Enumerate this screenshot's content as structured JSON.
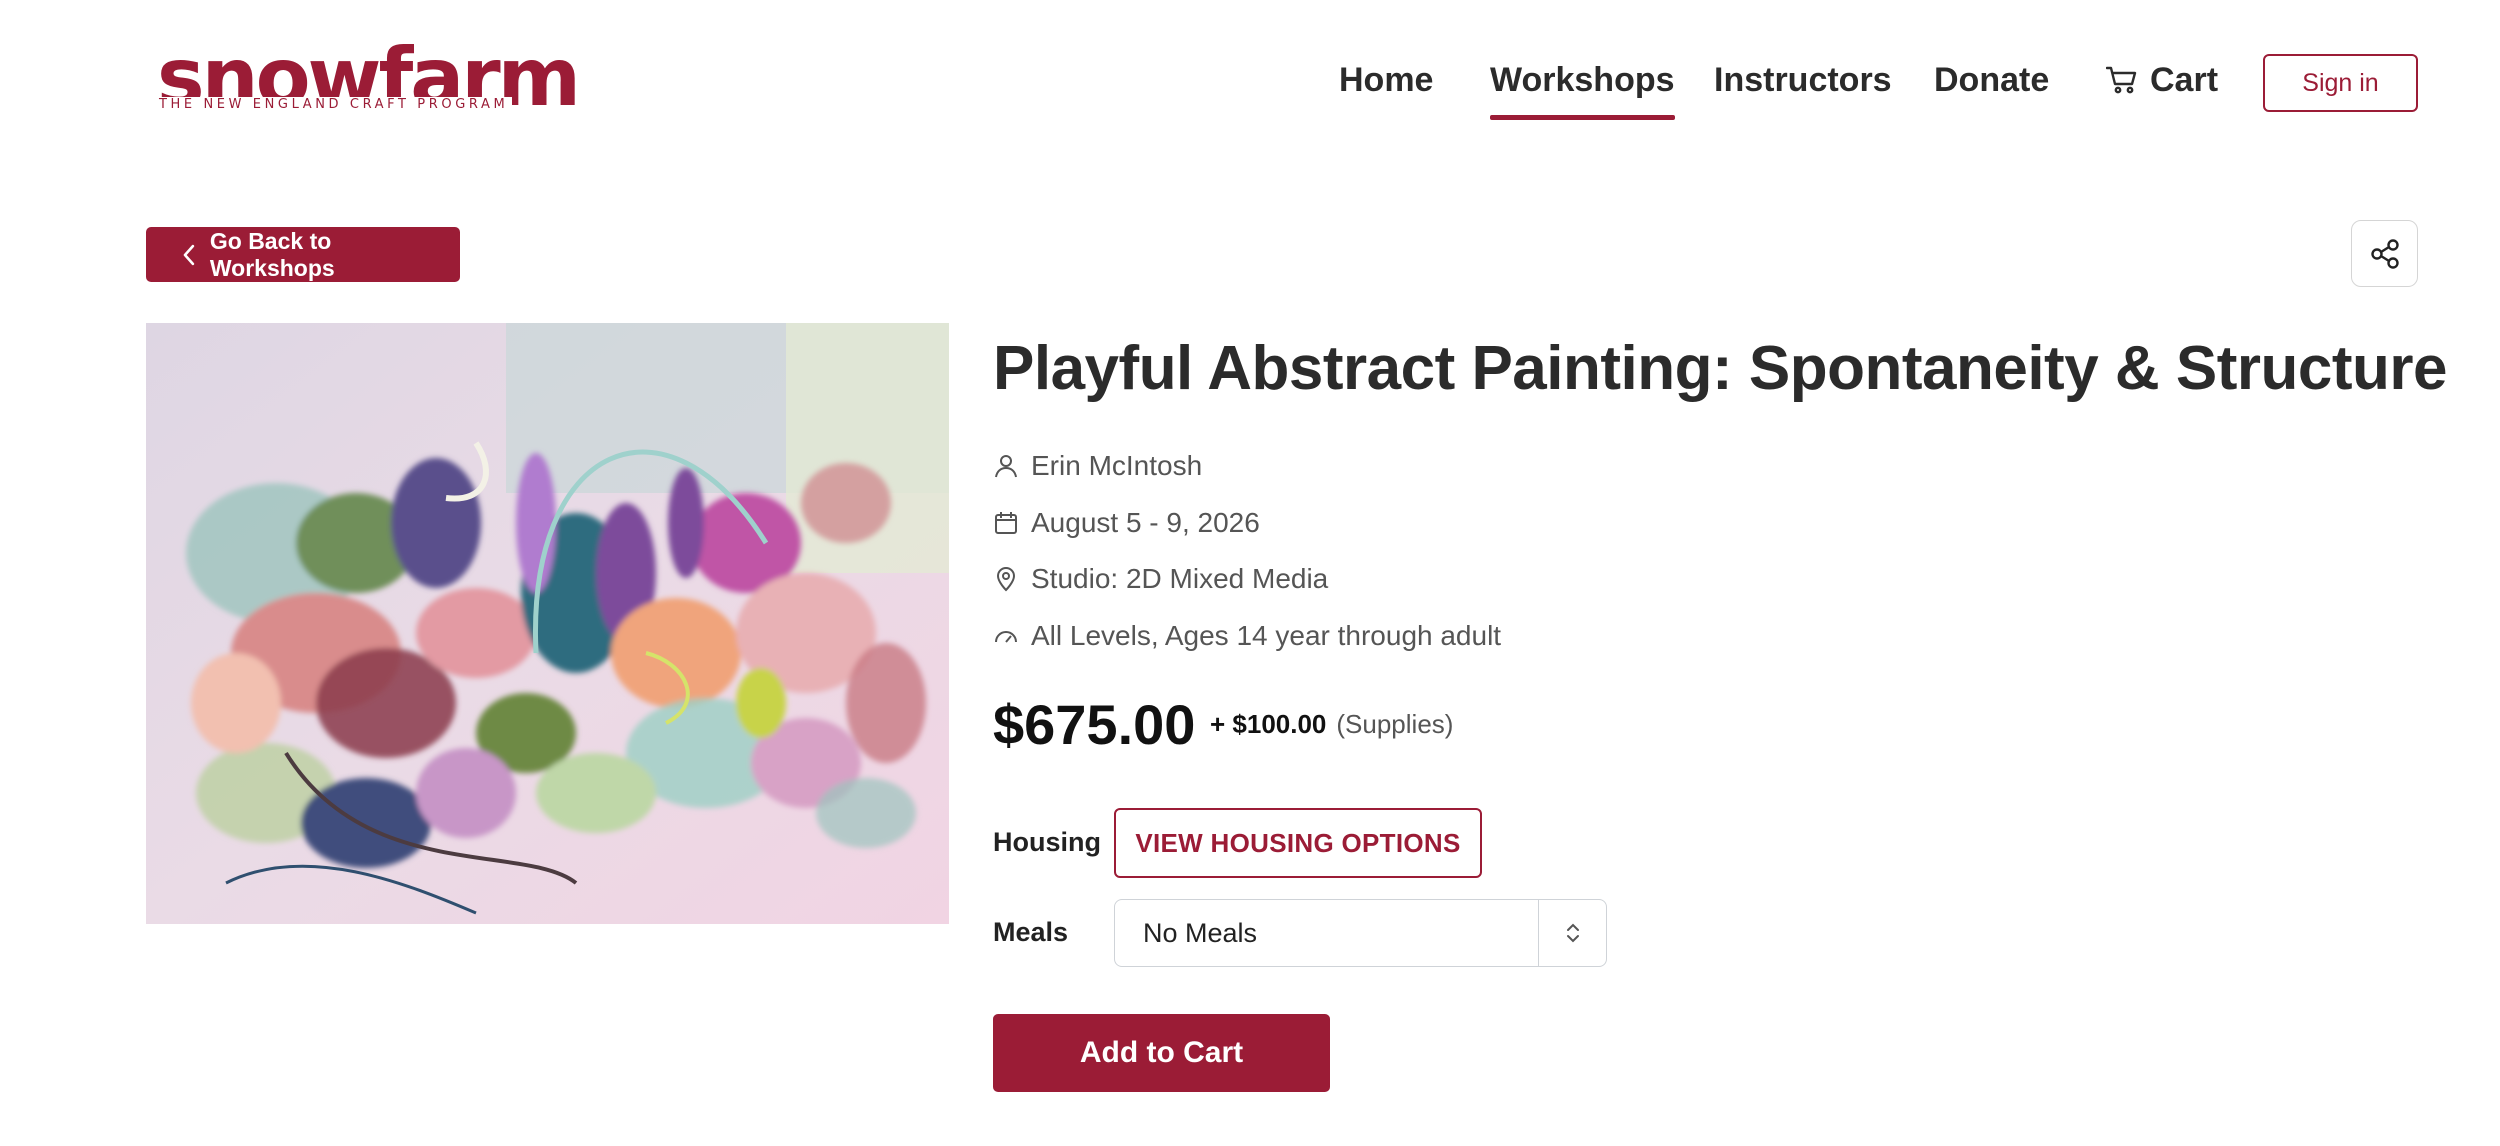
{
  "brand": {
    "name": "snowfarm",
    "tagline": "THE NEW ENGLAND CRAFT PROGRAM",
    "color": "#9b1c36"
  },
  "nav": {
    "items": [
      {
        "label": "Home"
      },
      {
        "label": "Workshops",
        "active": true
      },
      {
        "label": "Instructors"
      },
      {
        "label": "Donate"
      },
      {
        "label": "Cart",
        "icon": "cart-icon"
      }
    ],
    "signin_label": "Sign in"
  },
  "back_button": {
    "label": "Go Back to Workshops",
    "icon": "chevron-left-icon"
  },
  "share_button": {
    "icon": "share-icon"
  },
  "workshop": {
    "title": "Playful Abstract Painting: Spontaneity & Structure",
    "instructor": "Erin McIntosh",
    "dates": "August 5 - 9, 2026",
    "studio": "Studio: 2D Mixed Media",
    "levels": "All Levels, Ages 14 year through adult",
    "price": "$675.00",
    "supplies_amount": "+ $100.00",
    "supplies_label": "(Supplies)"
  },
  "form": {
    "housing_label": "Housing",
    "housing_button": "VIEW HOUSING OPTIONS",
    "meals_label": "Meals",
    "meals_selected": "No Meals",
    "add_to_cart": "Add to Cart"
  }
}
